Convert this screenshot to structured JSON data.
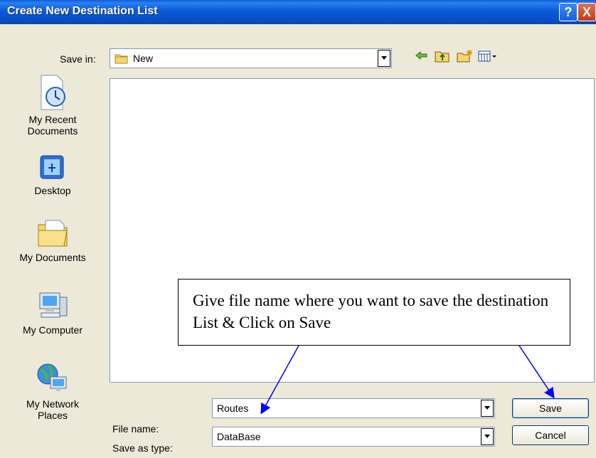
{
  "window": {
    "title": "Create New Destination List",
    "help_button": "?",
    "close_button": "X"
  },
  "save_in": {
    "label": "Save in:",
    "value": "New"
  },
  "toolbar": {
    "icons": [
      "back-icon",
      "up-folder-icon",
      "new-folder-icon",
      "views-menu-icon"
    ]
  },
  "places": [
    {
      "label": "My Recent Documents",
      "icon": "recent-documents-icon"
    },
    {
      "label": "Desktop",
      "icon": "desktop-icon"
    },
    {
      "label": "My Documents",
      "icon": "my-documents-icon"
    },
    {
      "label": "My Computer",
      "icon": "my-computer-icon"
    },
    {
      "label": "My Network Places",
      "icon": "network-places-icon"
    }
  ],
  "file_name": {
    "label": "File name:",
    "value": "Routes"
  },
  "save_as_type": {
    "label": "Save as type:",
    "value": "DataBase"
  },
  "buttons": {
    "save": "Save",
    "cancel": "Cancel"
  },
  "callout": {
    "text": "Give file name where you want to save the destination List & Click on Save"
  }
}
